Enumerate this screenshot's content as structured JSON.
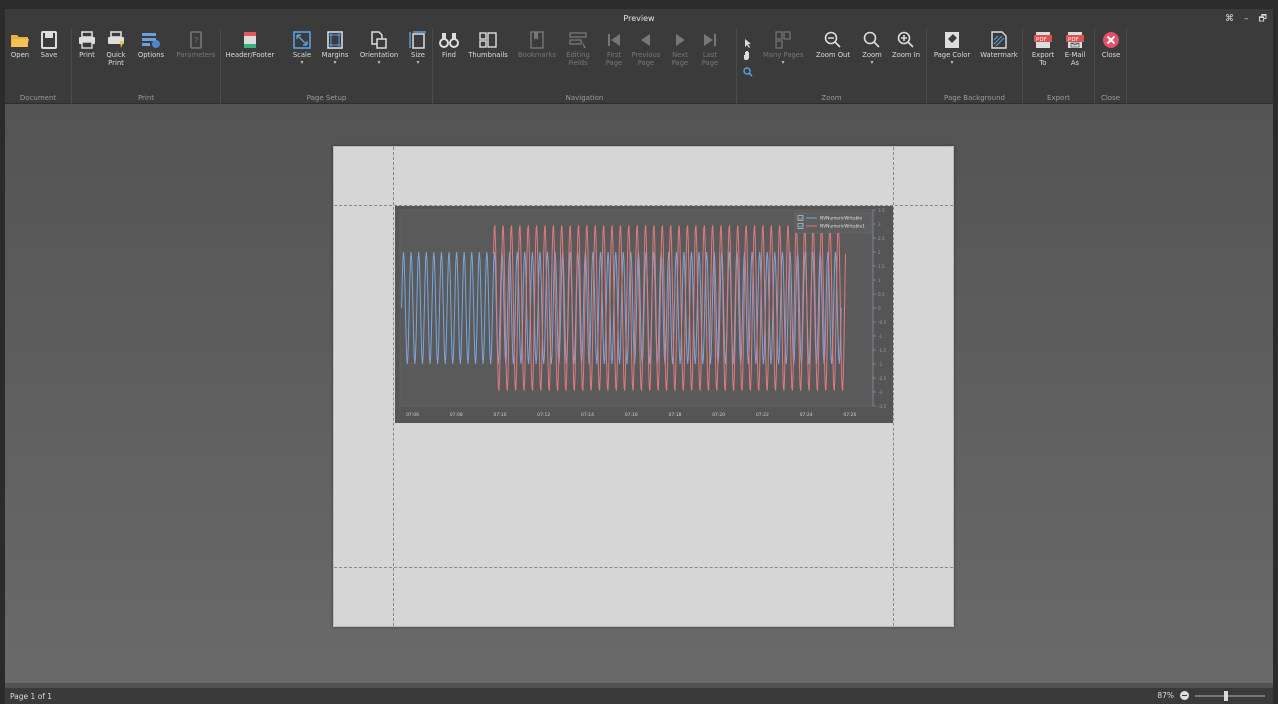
{
  "window": {
    "title": "Preview",
    "controls": [
      "⌘",
      "–",
      "🗗"
    ]
  },
  "ribbon": {
    "groups": [
      {
        "id": "document",
        "label": "Document",
        "buttons": [
          {
            "label": "Open"
          },
          {
            "label": "Save"
          }
        ]
      },
      {
        "id": "print",
        "label": "Print",
        "buttons": [
          {
            "label": "Print"
          },
          {
            "label": "Quick Print"
          },
          {
            "label": "Options"
          },
          {
            "label": "Parameters",
            "disabled": true
          }
        ]
      },
      {
        "id": "page_setup",
        "label": "Page Setup",
        "buttons": [
          {
            "label": "Header/Footer"
          },
          {
            "label": "Scale"
          },
          {
            "label": "Margins"
          },
          {
            "label": "Orientation"
          },
          {
            "label": "Size"
          }
        ]
      },
      {
        "id": "navigation",
        "label": "Navigation",
        "buttons": [
          {
            "label": "Find"
          },
          {
            "label": "Thumbnails"
          },
          {
            "label": "Bookmarks",
            "disabled": true
          },
          {
            "label": "Editing Fields",
            "disabled": true
          },
          {
            "label": "First Page",
            "disabled": true
          },
          {
            "label": "Previous Page",
            "disabled": true
          },
          {
            "label": "Next Page",
            "disabled": true
          },
          {
            "label": "Last Page",
            "disabled": true
          }
        ]
      },
      {
        "id": "zoom",
        "label": "Zoom",
        "buttons": [
          {
            "label": "Many Pages",
            "disabled": true
          },
          {
            "label": "Zoom Out"
          },
          {
            "label": "Zoom"
          },
          {
            "label": "Zoom In"
          }
        ]
      },
      {
        "id": "page_background",
        "label": "Page Background",
        "buttons": [
          {
            "label": "Page Color"
          },
          {
            "label": "Watermark"
          }
        ]
      },
      {
        "id": "export",
        "label": "Export",
        "buttons": [
          {
            "label": "Export To"
          },
          {
            "label": "E-Mail As"
          }
        ]
      },
      {
        "id": "close",
        "label": "Close",
        "buttons": [
          {
            "label": "Close"
          }
        ]
      }
    ]
  },
  "colors": {
    "series1": "#7aa6d8",
    "series2": "#e07a7f",
    "chart_bg": "#555555",
    "plot_bg": "#5a5a5a"
  },
  "chart_data": {
    "type": "line",
    "title": "",
    "xlabel": "",
    "ylabel": "",
    "x_ticks": [
      "07:06",
      "07:08",
      "07:10",
      "07:12",
      "07:14",
      "07:16",
      "07:18",
      "07:20",
      "07:22",
      "07:24",
      "07:26"
    ],
    "y_ticks": [
      "3.5",
      "3",
      "2.5",
      "2",
      "1.5",
      "1",
      "0.5",
      "0",
      "-0.5",
      "-1",
      "-1.5",
      "-2",
      "-2.5",
      "-3",
      "-3.5"
    ],
    "ylim": [
      -3.5,
      3.5
    ],
    "legend_position": "top-right",
    "series": [
      {
        "name": "NVNumericWritable",
        "color": "#7aa6d8",
        "amplitude": 2,
        "x_start": "07:05.5",
        "x_end": "07:25.6",
        "cycles": 58
      },
      {
        "name": "NVNumericWritable1",
        "color": "#e07a7f",
        "amplitude": 3,
        "x_start": "07:09.7",
        "x_end": "07:25.8",
        "cycles": 42
      }
    ]
  },
  "status": {
    "page_info": "Page 1 of 1",
    "zoom": "87%",
    "zoom_level": 0.87
  }
}
